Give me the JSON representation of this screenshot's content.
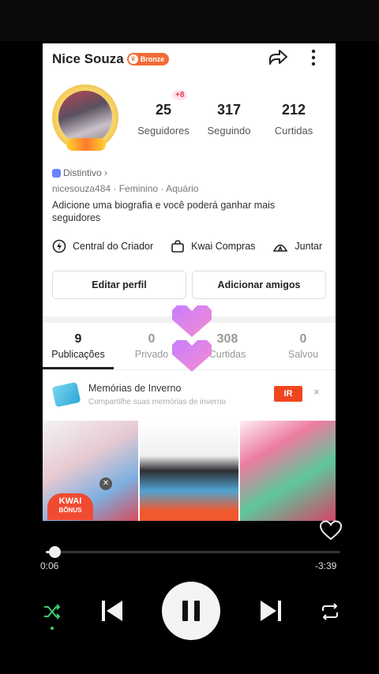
{
  "profile": {
    "name": "Nice Souza",
    "badge": "Bronze",
    "follower_delta": "+8",
    "stats": [
      {
        "value": "25",
        "label": "Seguidores"
      },
      {
        "value": "317",
        "label": "Seguindo"
      },
      {
        "value": "212",
        "label": "Curtidas"
      }
    ],
    "distintivo": "Distintivo",
    "meta": "nicesouza484 · Feminino · Aquário",
    "bio": "Adicione uma biografia e você poderá ganhar mais seguidores",
    "tools": [
      "Central do Criador",
      "Kwai Compras",
      "Juntar"
    ],
    "edit_button": "Editar perfil",
    "add_friends_button": "Adicionar amigos"
  },
  "tabs": [
    {
      "value": "9",
      "label": "Publicações",
      "active": true
    },
    {
      "value": "0",
      "label": "Privado"
    },
    {
      "value": "308",
      "label": "Curtidas"
    },
    {
      "value": "0",
      "label": "Salvou"
    }
  ],
  "memories": {
    "title": "Memórias de Inverno",
    "subtitle": "Compartilhe suas memórias de inverno",
    "button": "IR",
    "close": "×"
  },
  "thumbnails": {
    "kwai_label": "KWAI",
    "kwai_sub": "BÔNUS"
  },
  "player": {
    "elapsed": "0:06",
    "remaining": "-3:39",
    "progress": 0.03
  },
  "colors": {
    "accent": "#f0461f",
    "badge": "#f26b38",
    "shuffle_active": "#3ecf6e"
  },
  "icons": [
    "share-icon",
    "more-icon",
    "creator-icon",
    "shop-icon",
    "tent-icon",
    "heart-icon",
    "shuffle-icon",
    "previous-icon",
    "pause-icon",
    "next-icon",
    "repeat-icon"
  ]
}
